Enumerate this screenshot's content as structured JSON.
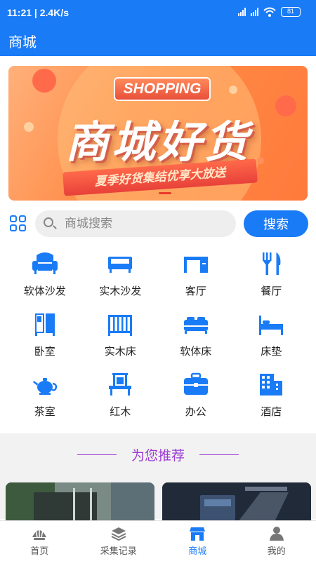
{
  "status": {
    "time": "11:21",
    "speed": "2.4K/s",
    "battery": "81"
  },
  "header": {
    "title": "商城"
  },
  "banner": {
    "tag": "SHOPPING",
    "headline": "商城好货",
    "ribbon": "夏季好货集结优享大放送"
  },
  "search": {
    "placeholder": "商城搜索",
    "button": "搜索"
  },
  "categories": [
    {
      "label": "软体沙发",
      "icon": "sofa-icon"
    },
    {
      "label": "实木沙发",
      "icon": "wood-sofa-icon"
    },
    {
      "label": "客厅",
      "icon": "living-room-icon"
    },
    {
      "label": "餐厅",
      "icon": "dining-icon"
    },
    {
      "label": "卧室",
      "icon": "wardrobe-icon"
    },
    {
      "label": "实木床",
      "icon": "crib-icon"
    },
    {
      "label": "软体床",
      "icon": "bed-icon"
    },
    {
      "label": "床垫",
      "icon": "mattress-icon"
    },
    {
      "label": "茶室",
      "icon": "teapot-icon"
    },
    {
      "label": "红木",
      "icon": "chair-icon"
    },
    {
      "label": "办公",
      "icon": "briefcase-icon"
    },
    {
      "label": "酒店",
      "icon": "hotel-icon"
    }
  ],
  "recommend": {
    "title": "为您推荐"
  },
  "tabs": [
    {
      "label": "首页",
      "icon": "shell-icon",
      "active": false
    },
    {
      "label": "采集记录",
      "icon": "layers-icon",
      "active": false
    },
    {
      "label": "商城",
      "icon": "store-icon",
      "active": true
    },
    {
      "label": "我的",
      "icon": "person-icon",
      "active": false
    }
  ],
  "colors": {
    "primary": "#1a7bf6",
    "recommend_title": "#9c3bd1",
    "tab_inactive": "#555555"
  }
}
